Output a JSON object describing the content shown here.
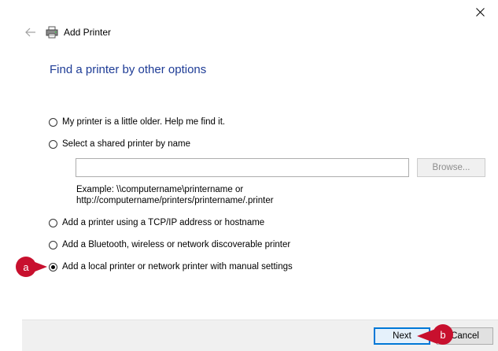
{
  "window": {
    "title": "Add Printer"
  },
  "page": {
    "heading": "Find a printer by other options"
  },
  "options": [
    {
      "label": "My printer is a little older. Help me find it.",
      "checked": false
    },
    {
      "label": "Select a shared printer by name",
      "checked": false
    },
    {
      "label": "Add a printer using a TCP/IP address or hostname",
      "checked": false
    },
    {
      "label": "Add a Bluetooth, wireless or network discoverable printer",
      "checked": false
    },
    {
      "label": "Add a local printer or network printer with manual settings",
      "checked": true
    }
  ],
  "shared_printer": {
    "input_value": "",
    "browse_label": "Browse...",
    "example_line1": "Example: \\\\computername\\printername or",
    "example_line2": "http://computername/printers/printername/.printer"
  },
  "footer": {
    "next_label": "Next",
    "cancel_label": "Cancel"
  },
  "callouts": {
    "a": "a",
    "b": "b"
  },
  "colors": {
    "heading": "#1e3c96",
    "callout": "#c8102e",
    "focus_border": "#0078d7"
  },
  "icons": {
    "close": "close-icon",
    "back": "back-arrow-icon",
    "printer": "printer-icon"
  }
}
